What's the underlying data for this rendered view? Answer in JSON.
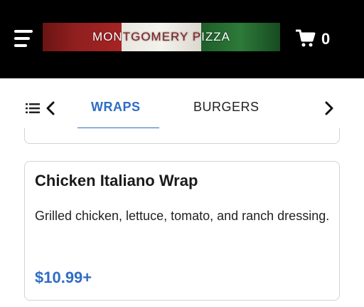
{
  "header": {
    "logo_text": "MONTGOMERY PIZZA",
    "cart_count": "0",
    "background": "#000000",
    "logo_colors": [
      "#8f1f1f",
      "#f4f2ed",
      "#2d7a39"
    ]
  },
  "nav": {
    "icons": [
      "menu-icon",
      "cart-icon",
      "list-icon",
      "chevron-left-icon",
      "chevron-right-icon"
    ],
    "tabs": [
      {
        "label": "WRAPS",
        "active": true
      },
      {
        "label": "BURGERS",
        "active": false
      }
    ],
    "accent": "#2f6dc4"
  },
  "items": [
    {
      "title": "Chicken Italiano Wrap",
      "description": "Grilled chicken, lettuce, tomato, and ranch dressing.",
      "price": "$10.99+"
    }
  ]
}
